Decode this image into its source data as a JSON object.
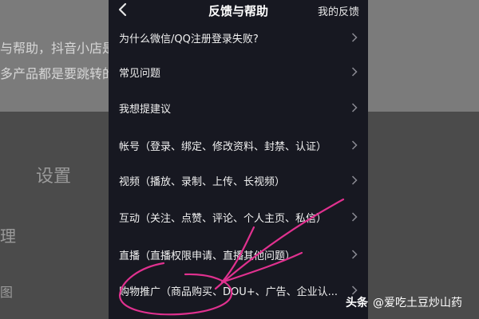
{
  "background": {
    "line1": "与帮助，抖音小店是",
    "line2": "多产品都是要跳转的",
    "settings": "设置",
    "side1": "理",
    "side2": "图"
  },
  "header": {
    "back_icon": "chevron-left-icon",
    "title": "反馈与帮助",
    "my_feedback": "我的反馈"
  },
  "items": [
    {
      "label": "为什么微信/QQ注册登录失败?"
    },
    {
      "label": "常见问题"
    },
    {
      "label": "我想提建议"
    },
    {
      "label": "帐号（登录、绑定、修改资料、封禁、认证）"
    },
    {
      "label": "视频（播放、录制、上传、长视频）"
    },
    {
      "label": "互动（关注、点赞、评论、个人主页、私信）"
    },
    {
      "label": "直播（直播权限申请、直播其他问题）"
    },
    {
      "label": "购物推广（商品购买、DOU+、广告、企业认..."
    }
  ],
  "watermark": {
    "brand": "头条",
    "handle": "@爱吃土豆炒山药"
  },
  "colors": {
    "screen_bg": "#171821",
    "annotation": "#e0318f"
  }
}
